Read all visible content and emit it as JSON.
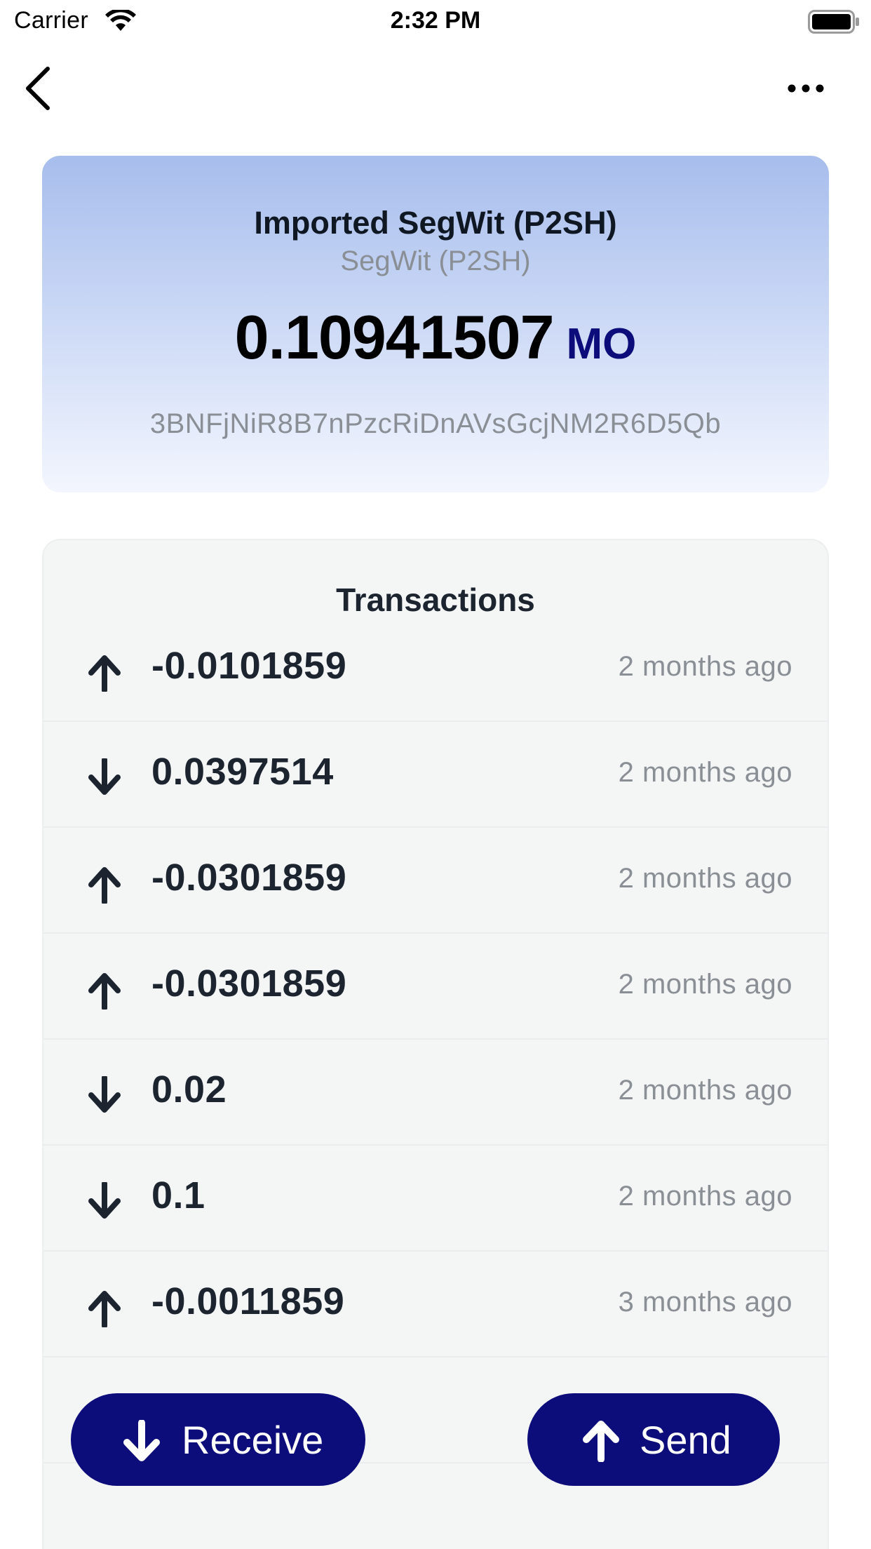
{
  "status_bar": {
    "carrier": "Carrier",
    "time": "2:32 PM",
    "wifi_icon": "wifi-icon",
    "battery_icon": "battery-icon"
  },
  "nav": {
    "back_icon": "chevron-left-icon",
    "more_icon": "more-horizontal-icon"
  },
  "wallet": {
    "label": "Imported SegWit (P2SH)",
    "type": "SegWit (P2SH)",
    "balance": "0.10941507",
    "unit": "MO",
    "address": "3BNFjNiR8B7nPzcRiDnAVsGcjNM2R6D5Qb",
    "gradient_top": "#a7bdec",
    "gradient_bottom": "#f3f6fe"
  },
  "transactions": {
    "title": "Transactions",
    "items": [
      {
        "direction": "out",
        "icon": "arrow-up-icon",
        "amount": "-0.0101859",
        "time": "2 months ago"
      },
      {
        "direction": "in",
        "icon": "arrow-down-icon",
        "amount": "0.0397514",
        "time": "2 months ago"
      },
      {
        "direction": "out",
        "icon": "arrow-up-icon",
        "amount": "-0.0301859",
        "time": "2 months ago"
      },
      {
        "direction": "out",
        "icon": "arrow-up-icon",
        "amount": "-0.0301859",
        "time": "2 months ago"
      },
      {
        "direction": "in",
        "icon": "arrow-down-icon",
        "amount": "0.02",
        "time": "2 months ago"
      },
      {
        "direction": "in",
        "icon": "arrow-down-icon",
        "amount": "0.1",
        "time": "2 months ago"
      },
      {
        "direction": "out",
        "icon": "arrow-up-icon",
        "amount": "-0.0011859",
        "time": "3 months ago"
      }
    ]
  },
  "actions": {
    "receive_label": "Receive",
    "send_label": "Send",
    "button_color": "#0c0c7a"
  }
}
